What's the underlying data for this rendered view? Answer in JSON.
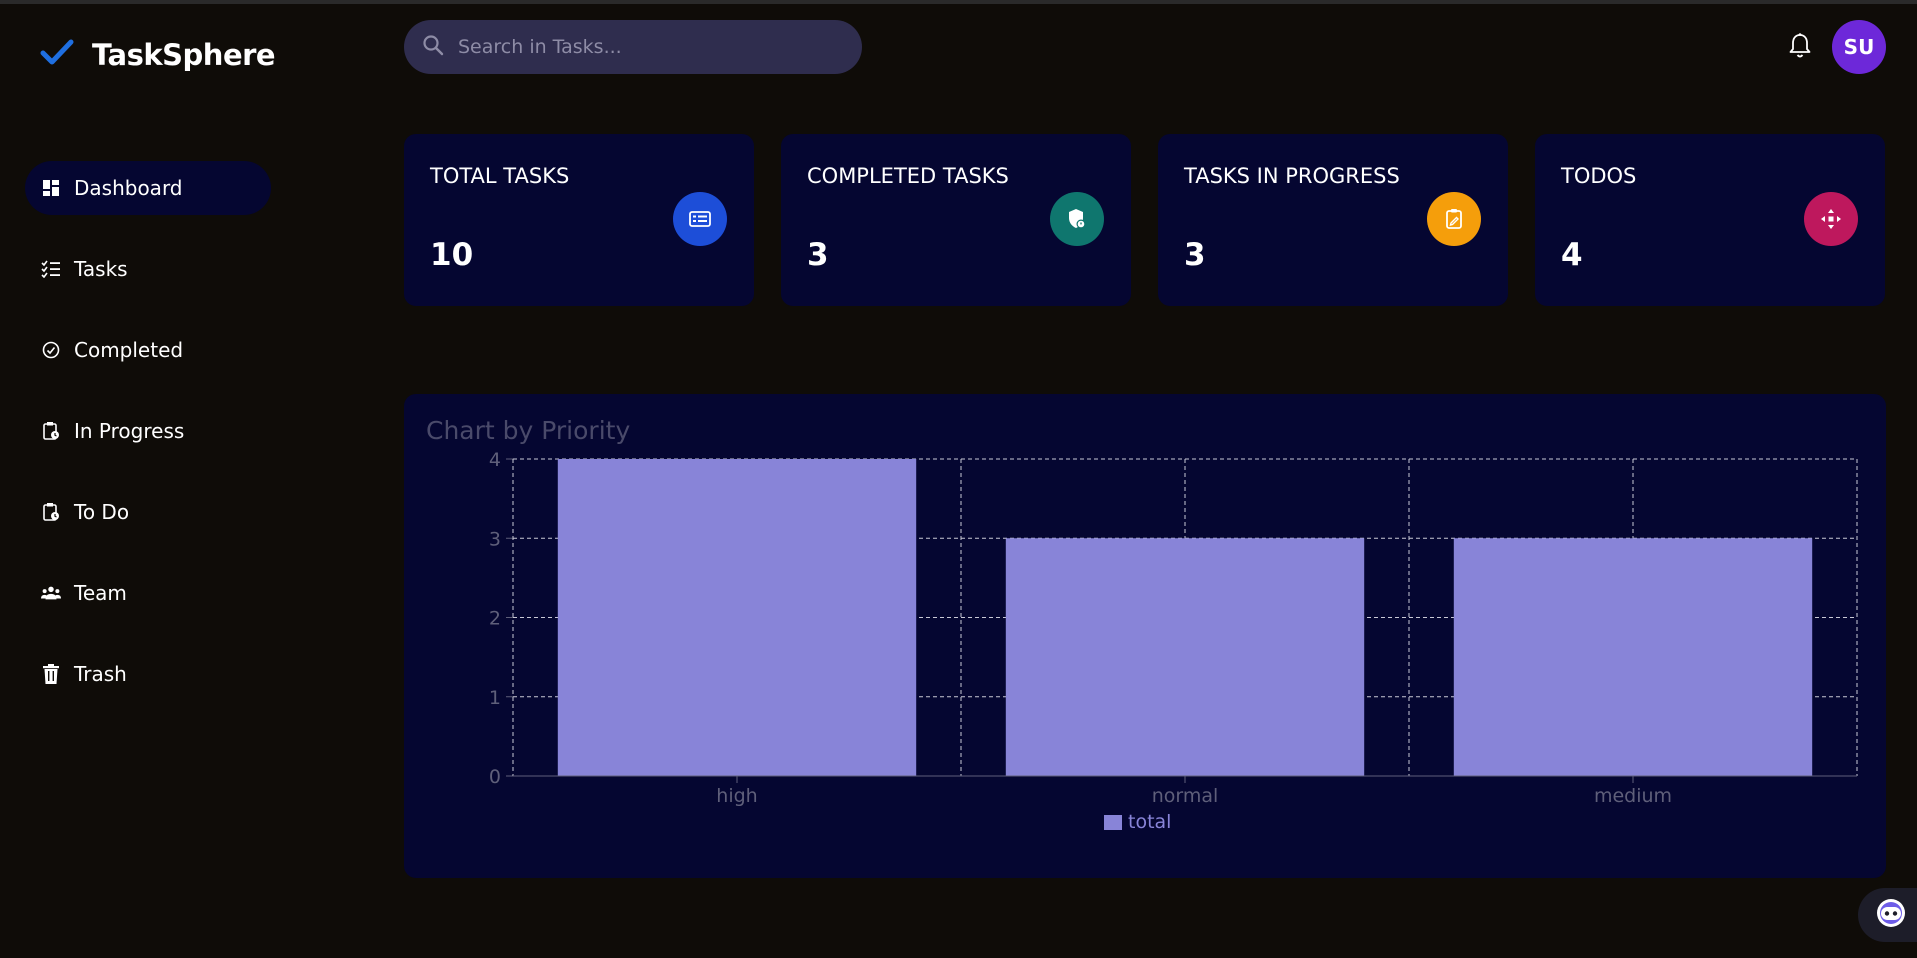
{
  "app": {
    "name": "TaskSphere"
  },
  "sidebar": {
    "items": [
      {
        "label": "Dashboard",
        "icon": "dashboard-icon",
        "active": true
      },
      {
        "label": "Tasks",
        "icon": "tasks-list-icon"
      },
      {
        "label": "Completed",
        "icon": "check-circle-icon"
      },
      {
        "label": "In Progress",
        "icon": "clipboard-clock-icon"
      },
      {
        "label": "To Do",
        "icon": "clipboard-clock-icon"
      },
      {
        "label": "Team",
        "icon": "team-icon"
      },
      {
        "label": "Trash",
        "icon": "trash-icon"
      }
    ]
  },
  "header": {
    "search_placeholder": "Search in Tasks...",
    "avatar_initials": "SU"
  },
  "stats": [
    {
      "label": "TOTAL TASKS",
      "value": "10",
      "icon": "list-icon",
      "color": "#1d4ed8"
    },
    {
      "label": "COMPLETED TASKS",
      "value": "3",
      "icon": "shield-check-icon",
      "color": "#0f766e"
    },
    {
      "label": "TASKS IN PROGRESS",
      "value": "3",
      "icon": "clipboard-edit-icon",
      "color": "#f59e0b"
    },
    {
      "label": "TODOS",
      "value": "4",
      "icon": "arrows-move-icon",
      "color": "#be185d"
    }
  ],
  "chart": {
    "title": "Chart by Priority"
  },
  "chart_data": {
    "type": "bar",
    "title": "Chart by Priority",
    "categories": [
      "high",
      "normal",
      "medium"
    ],
    "series": [
      {
        "name": "total",
        "values": [
          4,
          3,
          3
        ],
        "color": "#8884d8"
      }
    ],
    "ylim": [
      0,
      4
    ],
    "yticks": [
      "0",
      "1",
      "2",
      "3",
      "4"
    ],
    "grid": true,
    "legend": "bottom-center"
  }
}
